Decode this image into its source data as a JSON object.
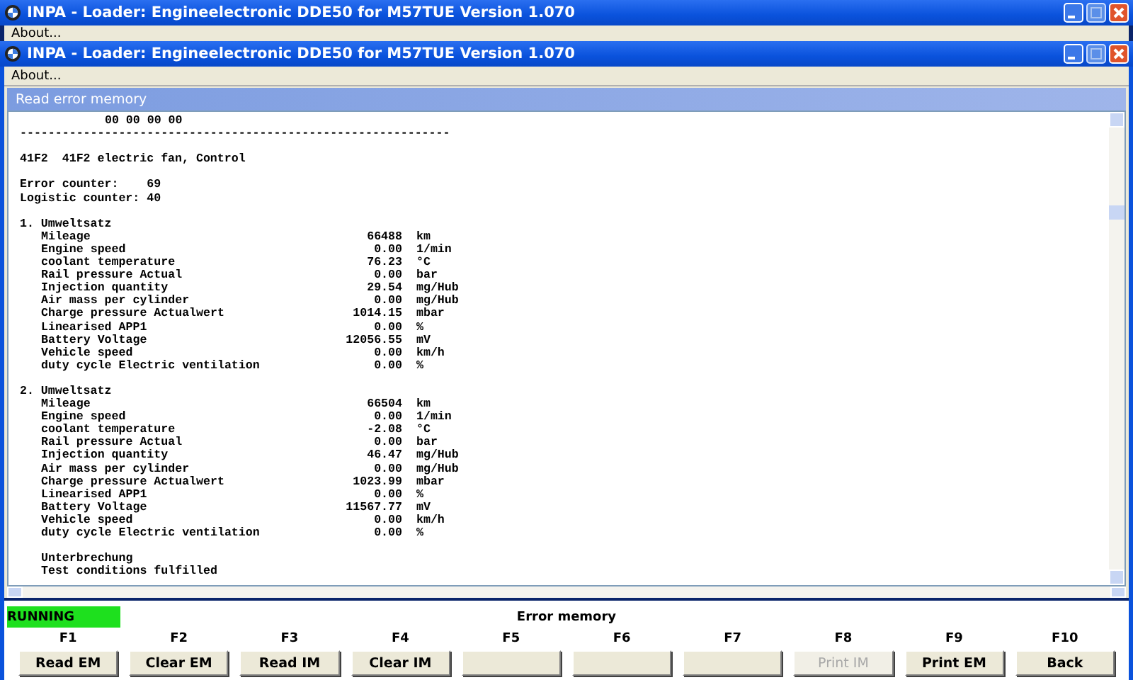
{
  "back_window": {
    "title": "INPA - Loader:  Engineelectronic DDE50 for M57TUE Version 1.070",
    "menu": [
      "About..."
    ]
  },
  "window": {
    "title": "INPA - Loader:  Engineelectronic DDE50 for M57TUE Version 1.070",
    "menu": [
      "About..."
    ]
  },
  "panel": {
    "title": "Read error memory",
    "lines": [
      {
        "kind": "header",
        "text": "00 00 00 00"
      },
      {
        "kind": "text",
        "text": "-------------------------------------------------------------"
      },
      {
        "kind": "blank"
      },
      {
        "kind": "text",
        "text": "41F2  41F2 electric fan, Control"
      },
      {
        "kind": "blank"
      },
      {
        "kind": "text",
        "text": "Error counter:    69"
      },
      {
        "kind": "text",
        "text": "Logistic counter: 40"
      },
      {
        "kind": "blank"
      },
      {
        "kind": "text",
        "text": "1. Umweltsatz"
      },
      {
        "kind": "row",
        "label": "Mileage",
        "value": "66488",
        "unit": "km"
      },
      {
        "kind": "row",
        "label": "Engine speed",
        "value": "0.00",
        "unit": "1/min"
      },
      {
        "kind": "row",
        "label": "coolant temperature",
        "value": "76.23",
        "unit": "°C"
      },
      {
        "kind": "row",
        "label": "Rail pressure Actual",
        "value": "0.00",
        "unit": "bar"
      },
      {
        "kind": "row",
        "label": "Injection quantity",
        "value": "29.54",
        "unit": "mg/Hub"
      },
      {
        "kind": "row",
        "label": "Air mass per cylinder",
        "value": "0.00",
        "unit": "mg/Hub"
      },
      {
        "kind": "row",
        "label": "Charge pressure Actualwert",
        "value": "1014.15",
        "unit": "mbar"
      },
      {
        "kind": "row",
        "label": "Linearised APP1",
        "value": "0.00",
        "unit": "%"
      },
      {
        "kind": "row",
        "label": "Battery Voltage",
        "value": "12056.55",
        "unit": "mV"
      },
      {
        "kind": "row",
        "label": "Vehicle speed",
        "value": "0.00",
        "unit": "km/h"
      },
      {
        "kind": "row",
        "label": "duty cycle Electric ventilation",
        "value": "0.00",
        "unit": "%"
      },
      {
        "kind": "blank"
      },
      {
        "kind": "text",
        "text": "2. Umweltsatz"
      },
      {
        "kind": "row",
        "label": "Mileage",
        "value": "66504",
        "unit": "km"
      },
      {
        "kind": "row",
        "label": "Engine speed",
        "value": "0.00",
        "unit": "1/min"
      },
      {
        "kind": "row",
        "label": "coolant temperature",
        "value": "-2.08",
        "unit": "°C"
      },
      {
        "kind": "row",
        "label": "Rail pressure Actual",
        "value": "0.00",
        "unit": "bar"
      },
      {
        "kind": "row",
        "label": "Injection quantity",
        "value": "46.47",
        "unit": "mg/Hub"
      },
      {
        "kind": "row",
        "label": "Air mass per cylinder",
        "value": "0.00",
        "unit": "mg/Hub"
      },
      {
        "kind": "row",
        "label": "Charge pressure Actualwert",
        "value": "1023.99",
        "unit": "mbar"
      },
      {
        "kind": "row",
        "label": "Linearised APP1",
        "value": "0.00",
        "unit": "%"
      },
      {
        "kind": "row",
        "label": "Battery Voltage",
        "value": "11567.77",
        "unit": "mV"
      },
      {
        "kind": "row",
        "label": "Vehicle speed",
        "value": "0.00",
        "unit": "km/h"
      },
      {
        "kind": "row",
        "label": "duty cycle Electric ventilation",
        "value": "0.00",
        "unit": "%"
      },
      {
        "kind": "blank"
      },
      {
        "kind": "sub",
        "text": "Unterbrechung"
      },
      {
        "kind": "sub",
        "text": "Test conditions fulfilled"
      }
    ]
  },
  "status_bar": {
    "state": "RUNNING",
    "title": "Error memory"
  },
  "function_keys": [
    {
      "key": "F1",
      "label": "Read EM",
      "disabled": false
    },
    {
      "key": "F2",
      "label": "Clear EM",
      "disabled": false
    },
    {
      "key": "F3",
      "label": "Read IM",
      "disabled": false
    },
    {
      "key": "F4",
      "label": "Clear IM",
      "disabled": false
    },
    {
      "key": "F5",
      "disabled": false
    },
    {
      "key": "F6",
      "disabled": false
    },
    {
      "key": "F7",
      "disabled": false
    },
    {
      "key": "F8",
      "label": "Print IM",
      "disabled": true
    },
    {
      "key": "F9",
      "label": "Print EM",
      "disabled": false
    },
    {
      "key": "F10",
      "label": "Back",
      "disabled": false
    }
  ]
}
